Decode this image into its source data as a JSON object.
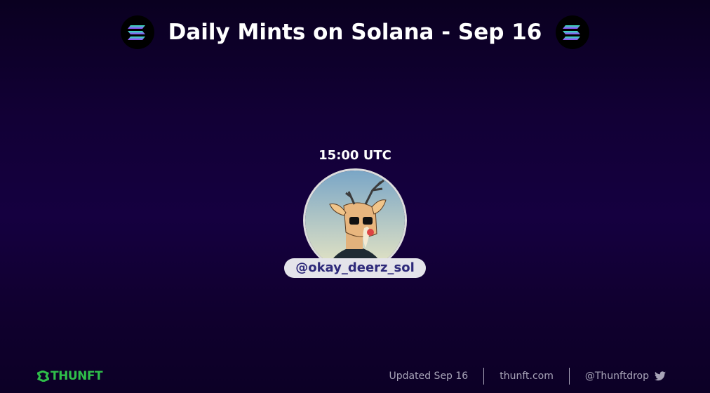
{
  "header": {
    "title": "Daily Mints on Solana - Sep 16",
    "logo_icon": "solana-logo-icon"
  },
  "mint": {
    "time": "15:00 UTC",
    "handle": "@okay_deerz_sol",
    "avatar_icon": "deer-avatar"
  },
  "footer": {
    "brand": "THUNFT",
    "updated": "Updated Sep 16",
    "site": "thunft.com",
    "twitter": "@Thunftdrop",
    "twitter_icon": "twitter-icon"
  },
  "colors": {
    "brand_green": "#2fbf4a",
    "handle_text": "#2e2a7a"
  }
}
